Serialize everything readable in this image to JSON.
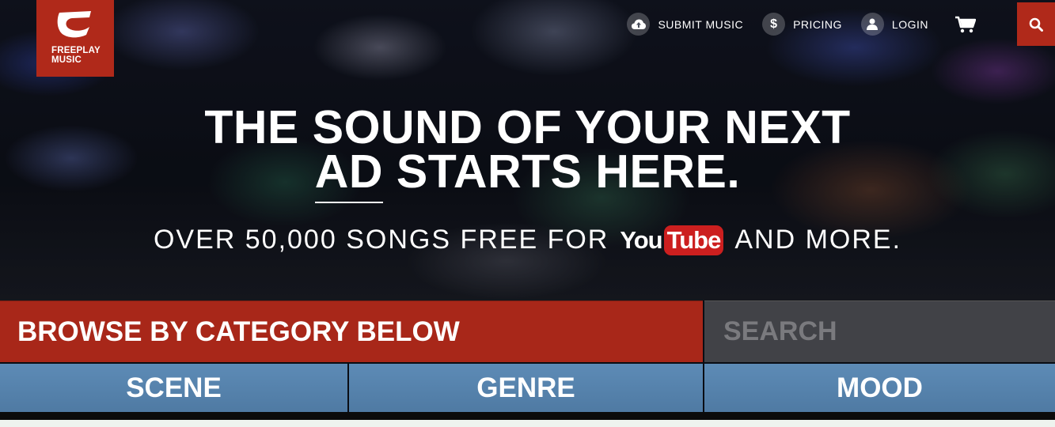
{
  "logo": {
    "line1": "FREEPLAY",
    "line2": "MUSIC"
  },
  "nav": {
    "submit": {
      "label": "SUBMIT MUSIC",
      "icon": "cloud-upload-icon"
    },
    "pricing": {
      "label": "PRICING",
      "icon": "dollar-icon",
      "glyph": "$"
    },
    "login": {
      "label": "LOGIN",
      "icon": "user-icon"
    },
    "cart_icon": "cart-icon",
    "search_icon": "search-icon"
  },
  "hero": {
    "headline_line1": "THE SOUND OF YOUR NEXT",
    "headline_line2_underlined": "AD",
    "headline_line2_rest": " STARTS HERE.",
    "sub_prefix": "OVER 50,000 SONGS FREE FOR",
    "youtube_you": "You",
    "youtube_tube": "Tube",
    "sub_suffix": "AND MORE."
  },
  "browse": {
    "label": "BROWSE BY CATEGORY BELOW",
    "search_placeholder": "SEARCH"
  },
  "categories": [
    "SCENE",
    "GENRE",
    "MOOD"
  ],
  "colors": {
    "brand_red": "#b0291a",
    "category_blue": "#5584b0",
    "youtube_red": "#cc1f1f"
  }
}
